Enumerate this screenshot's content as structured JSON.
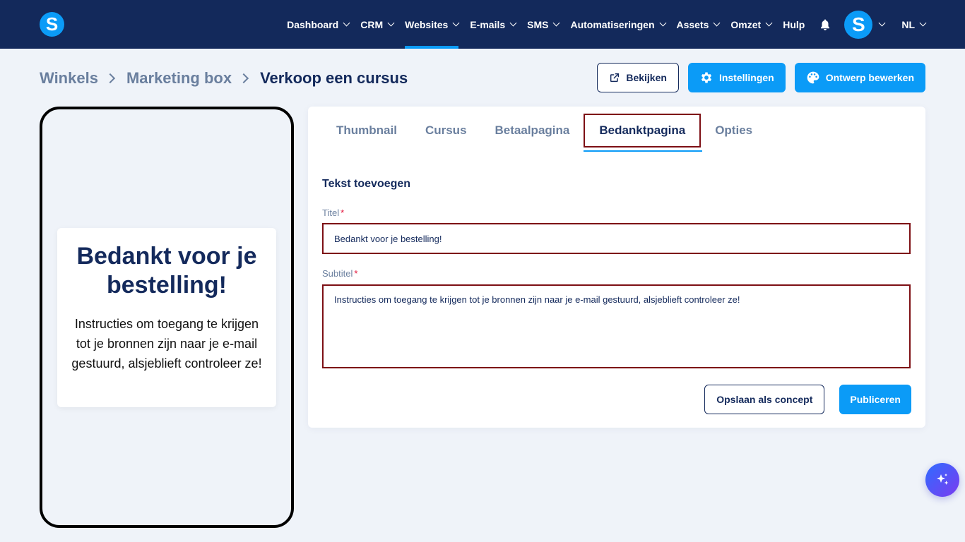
{
  "app": {
    "logo_letter": "S"
  },
  "nav": {
    "items": [
      {
        "label": "Dashboard",
        "has_dropdown": true,
        "active": false
      },
      {
        "label": "CRM",
        "has_dropdown": true,
        "active": false
      },
      {
        "label": "Websites",
        "has_dropdown": true,
        "active": true
      },
      {
        "label": "E-mails",
        "has_dropdown": true,
        "active": false
      },
      {
        "label": "SMS",
        "has_dropdown": true,
        "active": false
      },
      {
        "label": "Automatiseringen",
        "has_dropdown": true,
        "active": false
      },
      {
        "label": "Assets",
        "has_dropdown": true,
        "active": false
      },
      {
        "label": "Omzet",
        "has_dropdown": true,
        "active": false
      },
      {
        "label": "Hulp",
        "has_dropdown": false,
        "active": false
      }
    ],
    "bell_icon": "bell-icon",
    "avatar_letter": "S",
    "language": "NL"
  },
  "breadcrumb": {
    "items": [
      "Winkels",
      "Marketing box"
    ],
    "current": "Verkoop een cursus"
  },
  "actions": {
    "view_label": "Bekijken",
    "settings_label": "Instellingen",
    "design_label": "Ontwerp bewerken"
  },
  "preview": {
    "title": "Bedankt voor je bestelling!",
    "subtitle": "Instructies om toegang te krijgen tot je bronnen zijn naar je e-mail gestuurd, alsjeblieft controleer ze!"
  },
  "tabs": [
    {
      "label": "Thumbnail",
      "active": false
    },
    {
      "label": "Cursus",
      "active": false
    },
    {
      "label": "Betaalpagina",
      "active": false
    },
    {
      "label": "Bedanktpagina",
      "active": true
    },
    {
      "label": "Opties",
      "active": false
    }
  ],
  "form": {
    "section_title": "Tekst toevoegen",
    "title_label": "Titel",
    "title_value": "Bedankt voor je bestelling!",
    "subtitle_label": "Subtitel",
    "subtitle_value": "Instructies om toegang te krijgen tot je bronnen zijn naar je e-mail gestuurd, alsjeblieft controleer ze!",
    "required_mark": "*"
  },
  "footer_actions": {
    "concept_label": "Opslaan als concept",
    "publish_label": "Publiceren"
  },
  "colors": {
    "nav_bg": "#13295b",
    "accent": "#0b9bf7",
    "highlight_border": "#7d0f14",
    "text_dark": "#142a5c",
    "text_muted": "#6a7f9e"
  }
}
